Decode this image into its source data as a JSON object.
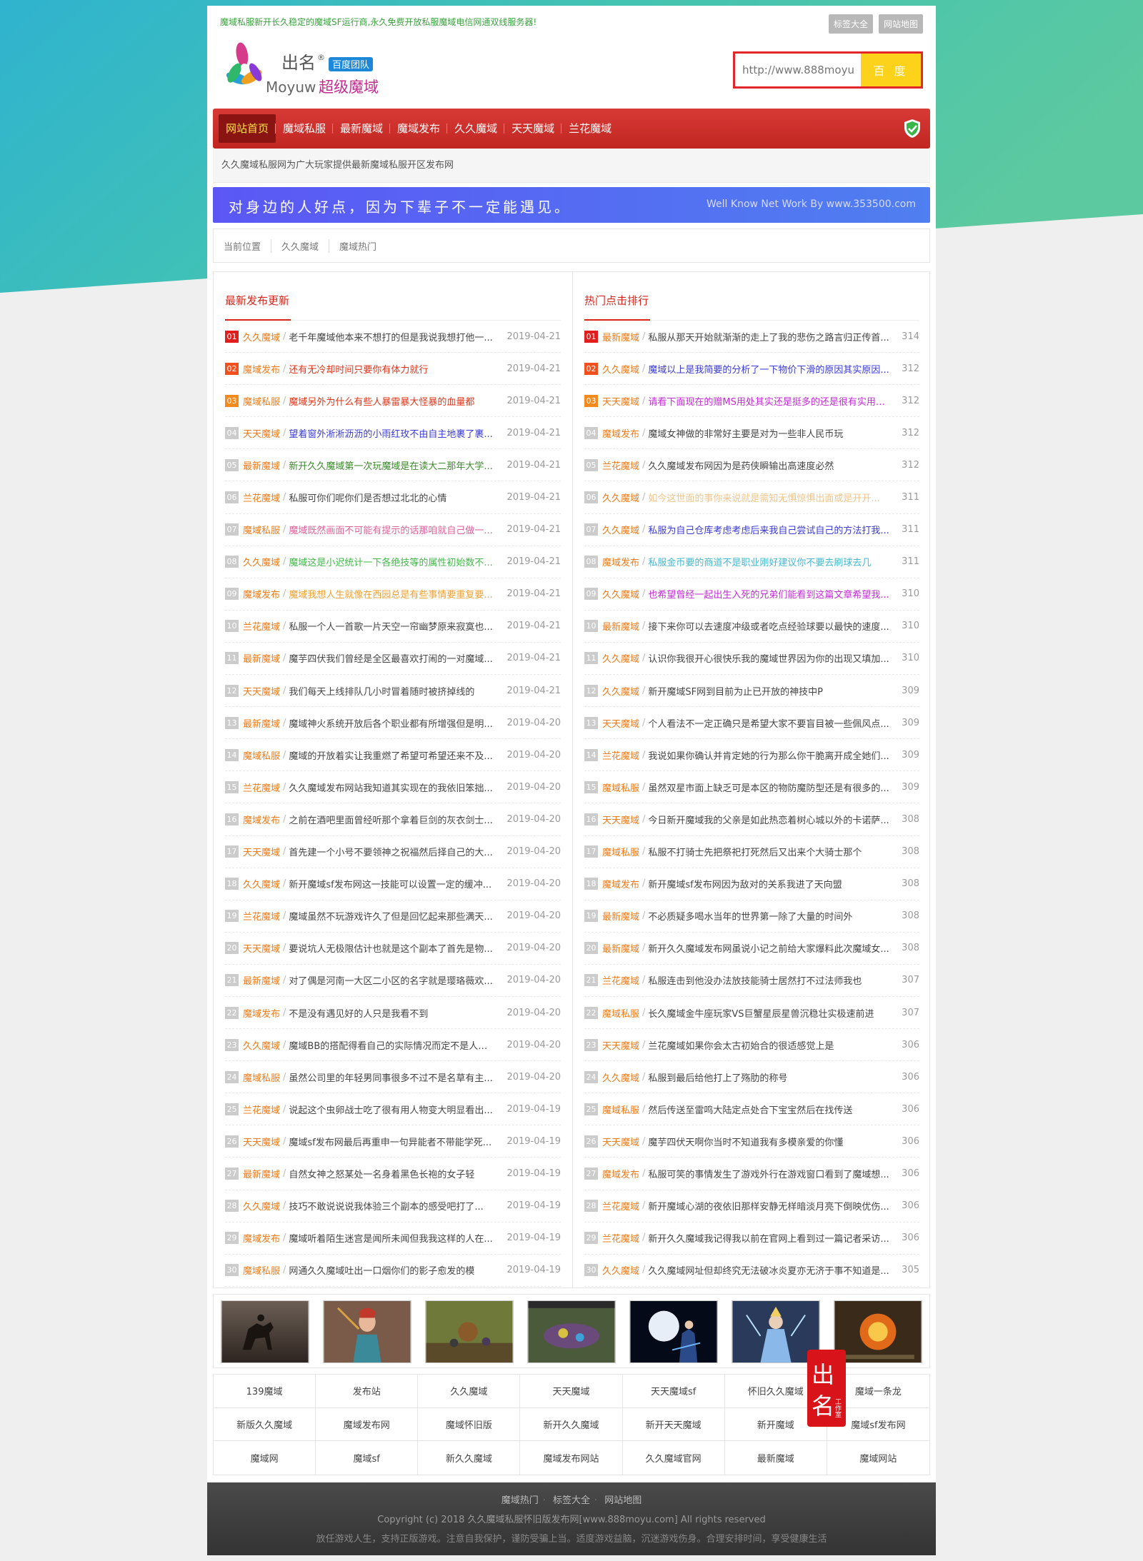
{
  "header": {
    "topline": "魔域私服新开长久稳定的魔域SF运行商,永久免费开放私服魔域电信网通双线服务器!",
    "toplinks": [
      "标签大全",
      "网站地图"
    ],
    "logo": {
      "brand": "出名",
      "sub": "Moyuw",
      "badge": "百度团队",
      "title": "超级魔域"
    },
    "search": {
      "placeholder": "http://www.888moyu.com",
      "button": "百 度"
    }
  },
  "nav": {
    "items": [
      "网站首页",
      "魔域私服",
      "最新魔域",
      "魔域发布",
      "久久魔域",
      "天天魔域",
      "兰花魔域"
    ],
    "active": 0
  },
  "subline": "久久魔域私服网为广大玩家提供最新魔域私服开区发布网",
  "banner": {
    "slogan": "对身边的人好点，因为下辈子不一定能遇见。",
    "credit": "Well Know Net Work By www.353500.com"
  },
  "breadcrumb": [
    "当前位置",
    "久久魔域",
    "魔域热门"
  ],
  "colors": {
    "accent": "#d7261c",
    "category": "#ef7b18"
  },
  "latest": {
    "title": "最新发布更新",
    "rows": [
      {
        "n": "01",
        "cat": "久久魔域",
        "title": "老千年魔域他本来不想打的但是我说我想打他一...",
        "date": "2019-04-21",
        "color": "#444"
      },
      {
        "n": "02",
        "cat": "魔域发布",
        "title": "还有无冷却时间只要你有体力就行",
        "date": "2019-04-21",
        "color": "#e0341a"
      },
      {
        "n": "03",
        "cat": "魔域私服",
        "title": "魔域另外为什么有些人暴雷暴大怪暴的血量都",
        "date": "2019-04-21",
        "color": "#e0341a"
      },
      {
        "n": "04",
        "cat": "天天魔域",
        "title": "望着窗外淅淅沥沥的小雨红玫不由自主地裹了裹...",
        "date": "2019-04-21",
        "color": "#3a3ad6"
      },
      {
        "n": "05",
        "cat": "最新魔域",
        "title": "新开久久魔域第一次玩魔域是在读大二那年大学...",
        "date": "2019-04-21",
        "color": "#3a8a2a"
      },
      {
        "n": "06",
        "cat": "兰花魔域",
        "title": "私服可你们呢你们是否想过北北的心情",
        "date": "2019-04-21",
        "color": "#444"
      },
      {
        "n": "07",
        "cat": "魔域私服",
        "title": "魔域既然画面不可能有提示的话那咱就自己做一...",
        "date": "2019-04-21",
        "color": "#e0609a"
      },
      {
        "n": "08",
        "cat": "久久魔域",
        "title": "魔域这是小迟统计一下各绝技等的属性初始数不...",
        "date": "2019-04-21",
        "color": "#42b84a"
      },
      {
        "n": "09",
        "cat": "魔域发布",
        "title": "魔域我想人生就像在西园总是有些事情要重复要...",
        "date": "2019-04-21",
        "color": "#f0a030"
      },
      {
        "n": "10",
        "cat": "兰花魔域",
        "title": "私服一个人一首歌一片天空一帘幽梦原来寂寞也...",
        "date": "2019-04-21",
        "color": "#444"
      },
      {
        "n": "11",
        "cat": "最新魔域",
        "title": "魔芋四伏我们曾经是全区最喜欢打闹的一对魔域...",
        "date": "2019-04-21",
        "color": "#444"
      },
      {
        "n": "12",
        "cat": "天天魔域",
        "title": "我们每天上线排队几小时冒着随时被挤掉线的",
        "date": "2019-04-21",
        "color": "#444"
      },
      {
        "n": "13",
        "cat": "最新魔域",
        "title": "魔域神火系统开放后各个职业都有所增强但是明...",
        "date": "2019-04-20",
        "color": "#444"
      },
      {
        "n": "14",
        "cat": "魔域私服",
        "title": "魔域的开放着实让我重燃了希望可希望还来不及...",
        "date": "2019-04-20",
        "color": "#444"
      },
      {
        "n": "15",
        "cat": "兰花魔域",
        "title": "久久魔域发布网站我知道其实现在的我依旧笨拙...",
        "date": "2019-04-20",
        "color": "#444"
      },
      {
        "n": "16",
        "cat": "魔域发布",
        "title": "之前在酒吧里面曾经听那个拿着巨剑的灰衣剑士...",
        "date": "2019-04-20",
        "color": "#444"
      },
      {
        "n": "17",
        "cat": "天天魔域",
        "title": "首先建一个小号不要领神之祝福然后择自己的大...",
        "date": "2019-04-20",
        "color": "#444"
      },
      {
        "n": "18",
        "cat": "久久魔域",
        "title": "新开魔域sf发布网这一技能可以设置一定的缓冲...",
        "date": "2019-04-20",
        "color": "#444"
      },
      {
        "n": "19",
        "cat": "兰花魔域",
        "title": "魔域虽然不玩游戏许久了但是回忆起来那些满天...",
        "date": "2019-04-20",
        "color": "#444"
      },
      {
        "n": "20",
        "cat": "天天魔域",
        "title": "要说坑人无极限估计也就是这个副本了首先是物...",
        "date": "2019-04-20",
        "color": "#444"
      },
      {
        "n": "21",
        "cat": "最新魔域",
        "title": "对了偶是河南一大区二小区的名字就是璎珞薇欢...",
        "date": "2019-04-20",
        "color": "#444"
      },
      {
        "n": "22",
        "cat": "魔域发布",
        "title": "不是没有遇见好的人只是我看不到",
        "date": "2019-04-20",
        "color": "#444"
      },
      {
        "n": "23",
        "cat": "久久魔域",
        "title": "魔域BB的搭配得看自己的实际情况而定不是人说...",
        "date": "2019-04-20",
        "color": "#444"
      },
      {
        "n": "24",
        "cat": "魔域私服",
        "title": "虽然公司里的年轻男同事很多不过不是名草有主...",
        "date": "2019-04-20",
        "color": "#444"
      },
      {
        "n": "25",
        "cat": "兰花魔域",
        "title": "说起这个虫卵战士吃了很有用人物变大明显看出...",
        "date": "2019-04-19",
        "color": "#444"
      },
      {
        "n": "26",
        "cat": "天天魔域",
        "title": "魔域sf发布网最后再重申一句异能者不带能学死...",
        "date": "2019-04-19",
        "color": "#444"
      },
      {
        "n": "27",
        "cat": "最新魔域",
        "title": "自然女神之怒某处一名身着黑色长袍的女子轻",
        "date": "2019-04-19",
        "color": "#444"
      },
      {
        "n": "28",
        "cat": "久久魔域",
        "title": "技巧不敢说说说我体验三个副本的感受吧打了...",
        "date": "2019-04-19",
        "color": "#444"
      },
      {
        "n": "29",
        "cat": "魔域发布",
        "title": "魔域听着陌生迷宫是闻所未闻但我我这样的人在...",
        "date": "2019-04-19",
        "color": "#444"
      },
      {
        "n": "30",
        "cat": "魔域私服",
        "title": "网通久久魔域吐出一口烟你们的影子愈发的模",
        "date": "2019-04-19",
        "color": "#444"
      }
    ]
  },
  "hot": {
    "title": "热门点击排行",
    "rows": [
      {
        "n": "01",
        "cat": "最新魔域",
        "title": "私服从那天开始就渐渐的走上了我的悲伤之路言归正传首...",
        "count": "314",
        "color": "#444"
      },
      {
        "n": "02",
        "cat": "久久魔域",
        "title": "魔域以上是我简要的分析了一下物价下滑的原因其实原因...",
        "count": "312",
        "color": "#3a3ad6"
      },
      {
        "n": "03",
        "cat": "天天魔域",
        "title": "请看下面现在的赠MS用处其实还是挺多的还是很有实用性...",
        "count": "312",
        "color": "#c32ad6"
      },
      {
        "n": "04",
        "cat": "魔域发布",
        "title": "魔域女神做的非常好主要是对为一些非人民币玩",
        "count": "312",
        "color": "#444"
      },
      {
        "n": "05",
        "cat": "兰花魔域",
        "title": "久久魔域发布网因为是药侠瞬输出高速度必然",
        "count": "312",
        "color": "#444"
      },
      {
        "n": "06",
        "cat": "久久魔域",
        "title": "如今这世面的事你来说就是需知无惧惊惧出面或是开开...",
        "count": "311",
        "color": "#f0c48a"
      },
      {
        "n": "07",
        "cat": "久久魔域",
        "title": "私服为自己仓库考虑考虑后来我自己尝试自己的方法打我...",
        "count": "311",
        "color": "#3a3ad6"
      },
      {
        "n": "08",
        "cat": "魔域发布",
        "title": "私服金币要的商道不是职业刚好建议你不要去刷球去几",
        "count": "311",
        "color": "#42b8d0"
      },
      {
        "n": "09",
        "cat": "久久魔域",
        "title": "也希望曾经一起出生入死的兄弟们能看到这篇文章希望我...",
        "count": "310",
        "color": "#c32ad6"
      },
      {
        "n": "10",
        "cat": "最新魔域",
        "title": "接下来你可以去速度冲级或者吃点经验球要以最快的速度...",
        "count": "310",
        "color": "#444"
      },
      {
        "n": "11",
        "cat": "久久魔域",
        "title": "认识你我很开心很快乐我的魔域世界因为你的出现又填加...",
        "count": "310",
        "color": "#444"
      },
      {
        "n": "12",
        "cat": "久久魔域",
        "title": "新开魔域SF网到目前为止已开放的神技中P",
        "count": "309",
        "color": "#444"
      },
      {
        "n": "13",
        "cat": "天天魔域",
        "title": "个人看法不一定正确只是希望大家不要盲目被一些佩风点...",
        "count": "309",
        "color": "#444"
      },
      {
        "n": "14",
        "cat": "兰花魔域",
        "title": "我说如果你确认并肯定她的行为那么你干脆离开成全她们...",
        "count": "309",
        "color": "#444"
      },
      {
        "n": "15",
        "cat": "魔域私服",
        "title": "虽然双星市面上缺乏可是本区的物防魔防型还是有很多的...",
        "count": "309",
        "color": "#444"
      },
      {
        "n": "16",
        "cat": "天天魔域",
        "title": "今日新开魔域我的父亲是如此热恋着树心城以外的卡诺萨...",
        "count": "308",
        "color": "#444"
      },
      {
        "n": "17",
        "cat": "魔域私服",
        "title": "私服不打骑士先把祭祀打死然后又出来个大骑士那个",
        "count": "308",
        "color": "#444"
      },
      {
        "n": "18",
        "cat": "魔域发布",
        "title": "新开魔域sf发布网因为敌对的关系我进了天向盟",
        "count": "308",
        "color": "#444"
      },
      {
        "n": "19",
        "cat": "最新魔域",
        "title": "不必质疑多喝水当年的世界第一除了大量的时间外",
        "count": "308",
        "color": "#444"
      },
      {
        "n": "20",
        "cat": "最新魔域",
        "title": "新开久久魔域发布网虽说小记之前给大家爆料此次魔域女...",
        "count": "308",
        "color": "#444"
      },
      {
        "n": "21",
        "cat": "兰花魔域",
        "title": "私服连击到他没办法放技能骑士居然打不过法师我也",
        "count": "307",
        "color": "#444"
      },
      {
        "n": "22",
        "cat": "魔域私服",
        "title": "长久魔域金牛座玩家VS巨蟹星辰星兽沉稳壮实极速前进",
        "count": "307",
        "color": "#444"
      },
      {
        "n": "23",
        "cat": "天天魔域",
        "title": "兰花魔域如果你会太古初始合的很适感觉上是",
        "count": "306",
        "color": "#444"
      },
      {
        "n": "24",
        "cat": "久久魔域",
        "title": "私服到最后给他打上了殇肋的称号",
        "count": "306",
        "color": "#444"
      },
      {
        "n": "25",
        "cat": "魔域私服",
        "title": "然后传送至雷鸣大陆定点处合下宝宝然后在找传送",
        "count": "306",
        "color": "#444"
      },
      {
        "n": "26",
        "cat": "天天魔域",
        "title": "魔芋四伏天啊你当时不知道我有多模亲爱的你懂",
        "count": "306",
        "color": "#444"
      },
      {
        "n": "27",
        "cat": "魔域发布",
        "title": "私服可笑的事情发生了游戏外行在游戏窗口看到了魔域想...",
        "count": "306",
        "color": "#444"
      },
      {
        "n": "28",
        "cat": "兰花魔域",
        "title": "新开魔域心湖的夜依旧那样安静无样暗淡月亮下倒映优伤...",
        "count": "306",
        "color": "#444"
      },
      {
        "n": "29",
        "cat": "兰花魔域",
        "title": "新开久久魔域我记得我以前在官网上看到过一篇记者采访...",
        "count": "306",
        "color": "#444"
      },
      {
        "n": "30",
        "cat": "久久魔域",
        "title": "久久魔域网址但却终究无法破冰炎夏亦无济于事不知道是...",
        "count": "305",
        "color": "#444"
      }
    ]
  },
  "thumbs": [
    "thumb-horse-rider",
    "thumb-female-warrior",
    "thumb-game-scene",
    "thumb-game-battle",
    "thumb-moon-mage",
    "thumb-ice-hero",
    "thumb-fire-battle"
  ],
  "tags": [
    "139魔域",
    "发布站",
    "久久魔域",
    "天天魔域",
    "天天魔域sf",
    "怀旧久久魔域",
    "魔域一条龙",
    "新版久久魔域",
    "魔域发布网",
    "魔域怀旧版",
    "新开久久魔域",
    "新开天天魔域",
    "新开魔域",
    "魔域sf发布网",
    "魔域网",
    "魔域sf",
    "新久久魔域",
    "魔域发布网站",
    "久久魔域官网",
    "最新魔域",
    "魔域网站"
  ],
  "seal": {
    "text": "出名",
    "sub": "工作室"
  },
  "footer": {
    "links": [
      "魔域热门",
      "标签大全",
      "网站地图"
    ],
    "copyright": "Copyright (c) 2018 久久魔域私服怀旧版发布网[www.888moyu.com] All rights reserved",
    "slogan": "放任游戏人生，支持正版游戏。注意自我保护，谨防受骗上当。适度游戏益脑，沉迷游戏伤身。合理安排时间，享受健康生活"
  }
}
